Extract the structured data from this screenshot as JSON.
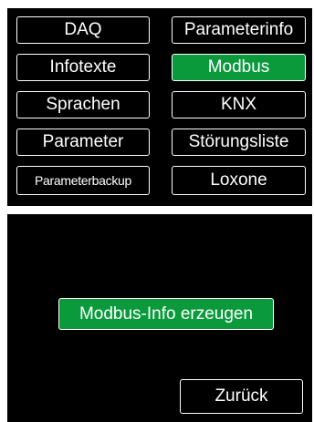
{
  "menu": {
    "items": [
      {
        "label": "DAQ",
        "active": false
      },
      {
        "label": "Parameterinfo",
        "active": false
      },
      {
        "label": "Infotexte",
        "active": false
      },
      {
        "label": "Modbus",
        "active": true
      },
      {
        "label": "Sprachen",
        "active": false
      },
      {
        "label": "KNX",
        "active": false
      },
      {
        "label": "Parameter",
        "active": false
      },
      {
        "label": "Störungsliste",
        "active": false
      },
      {
        "label": "Parameterbackup",
        "active": false
      },
      {
        "label": "Loxone",
        "active": false
      }
    ]
  },
  "action": {
    "generate_label": "Modbus-Info erzeugen",
    "back_label": "Zurück"
  },
  "colors": {
    "panel_bg": "#000000",
    "active_green": "#0a9a3c",
    "border": "#ffffff"
  }
}
